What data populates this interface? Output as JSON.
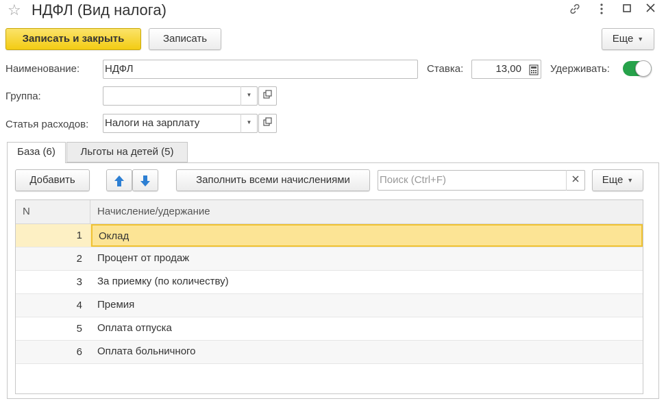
{
  "window": {
    "title": "НДФЛ (Вид налога)"
  },
  "toolbar": {
    "save_close_label": "Записать и закрыть",
    "save_label": "Записать",
    "more_label": "Еще"
  },
  "form": {
    "name_label": "Наименование:",
    "name_value": "НДФЛ",
    "rate_label": "Ставка:",
    "rate_value": "13,00",
    "withhold_label": "Удерживать:",
    "withhold_on": true,
    "group_label": "Группа:",
    "group_value": "",
    "expense_label": "Статья расходов:",
    "expense_value": "Налоги на зарплату"
  },
  "tabs": [
    {
      "label": "База (6)",
      "active": true
    },
    {
      "label": "Льготы на детей (5)",
      "active": false
    }
  ],
  "panel": {
    "add_label": "Добавить",
    "fill_label": "Заполнить всеми начислениями",
    "search_placeholder": "Поиск (Ctrl+F)",
    "more_label": "Еще"
  },
  "table": {
    "columns": [
      "N",
      "Начисление/удержание"
    ],
    "rows": [
      {
        "n": "1",
        "name": "Оклад"
      },
      {
        "n": "2",
        "name": "Процент от продаж"
      },
      {
        "n": "3",
        "name": "За приемку (по количеству)"
      },
      {
        "n": "4",
        "name": "Премия"
      },
      {
        "n": "5",
        "name": "Оплата отпуска"
      },
      {
        "n": "6",
        "name": "Оплата больничного"
      }
    ],
    "selected_row": 1
  },
  "colors": {
    "primary_button": "#f5d024",
    "toggle_on": "#26a24a",
    "selected_row": "#fce495",
    "arrow_blue": "#2d7fd3"
  },
  "icons": {
    "favorite": "star-icon",
    "link": "link-icon",
    "menu": "kebab-menu-icon",
    "maximize": "maximize-icon",
    "close": "close-icon",
    "calculator": "calculator-icon",
    "open": "open-form-icon",
    "up": "arrow-up-icon",
    "down": "arrow-down-icon",
    "clear": "clear-icon"
  }
}
